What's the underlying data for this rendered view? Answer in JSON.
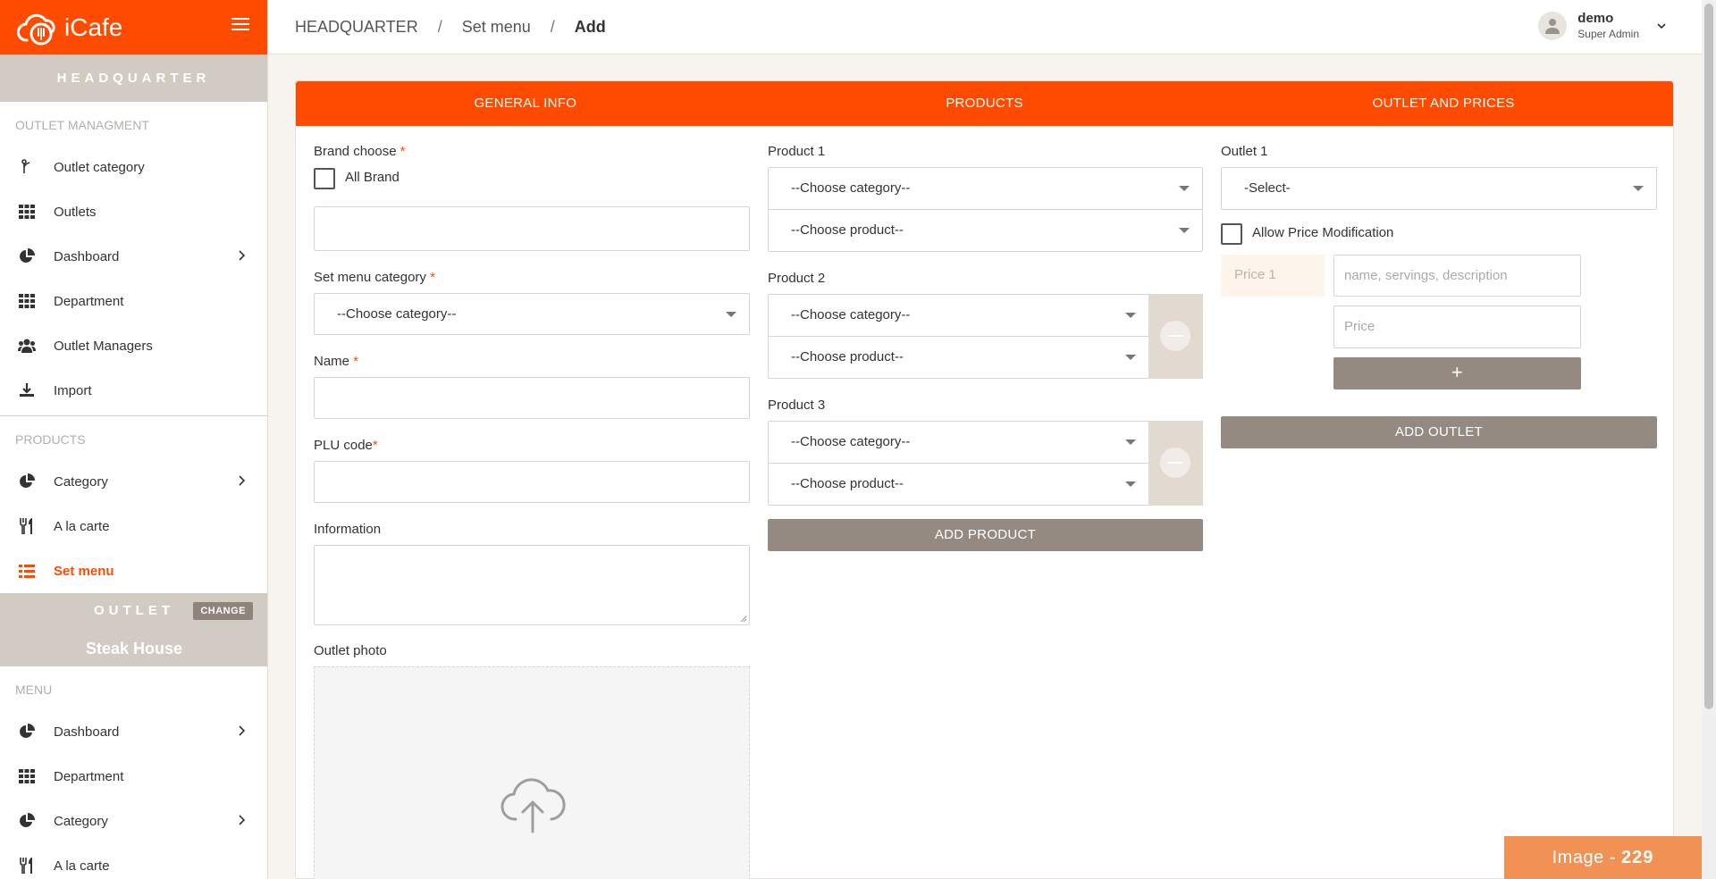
{
  "app": {
    "name": "iCafe"
  },
  "sidebar": {
    "headquarter_label": "HEADQUARTER",
    "outlet_management_label": "OUTLET MANAGMENT",
    "outlet_items": [
      {
        "label": "Outlet category",
        "icon": "branch-icon"
      },
      {
        "label": "Outlets",
        "icon": "grid-icon"
      },
      {
        "label": "Dashboard",
        "icon": "pie-chart-icon"
      },
      {
        "label": "Department",
        "icon": "grid-icon"
      },
      {
        "label": "Outlet Managers",
        "icon": "users-icon"
      },
      {
        "label": "Import",
        "icon": "download-icon"
      }
    ],
    "products_label": "PRODUCTS",
    "product_items": [
      {
        "label": "Category",
        "icon": "pie-chart-icon"
      },
      {
        "label": "A la carte",
        "icon": "cutlery-icon"
      },
      {
        "label": "Set menu",
        "icon": "list-icon",
        "active": true
      }
    ],
    "outlet_band": {
      "label": "OUTLET",
      "change": "CHANGE",
      "name": "Steak House"
    },
    "menu_label": "MENU",
    "menu_items": [
      {
        "label": "Dashboard",
        "icon": "pie-chart-icon"
      },
      {
        "label": "Department",
        "icon": "grid-icon"
      },
      {
        "label": "Category",
        "icon": "pie-chart-icon"
      },
      {
        "label": "A la carte",
        "icon": "cutlery-icon"
      }
    ]
  },
  "breadcrumb": {
    "items": [
      "HEADQUARTER",
      "Set menu",
      "Add"
    ],
    "separator": "/"
  },
  "user": {
    "name": "demo",
    "role": "Super Admin"
  },
  "tabs": [
    "GENERAL INFO",
    "PRODUCTS",
    "OUTLET AND PRICES"
  ],
  "general": {
    "brand_label": "Brand choose",
    "all_brand_label": "All Brand",
    "set_menu_category_label": "Set menu category",
    "category_placeholder": "--Choose category--",
    "name_label": "Name",
    "plu_label": "PLU code",
    "information_label": "Information",
    "outlet_photo_label": "Outlet photo",
    "required_mark": "*"
  },
  "products": {
    "items": [
      {
        "label": "Product 1",
        "category": "--Choose category--",
        "product": "--Choose product--"
      },
      {
        "label": "Product 2",
        "category": "--Choose category--",
        "product": "--Choose product--"
      },
      {
        "label": "Product 3",
        "category": "--Choose category--",
        "product": "--Choose product--"
      }
    ],
    "add_button": "ADD PRODUCT"
  },
  "outlets": {
    "outlet_label": "Outlet 1",
    "select_value": "-Select-",
    "allow_price_label": "Allow Price Modification",
    "price_label": "Price 1",
    "name_placeholder": "name, servings, description",
    "price_placeholder": "Price",
    "plus": "+",
    "add_button": "ADD OUTLET"
  },
  "badge": {
    "label": "Image - ",
    "number": "229"
  },
  "colors": {
    "accent": "#ff4b00",
    "gray_button": "#948a81",
    "band": "#d2cbc4"
  }
}
